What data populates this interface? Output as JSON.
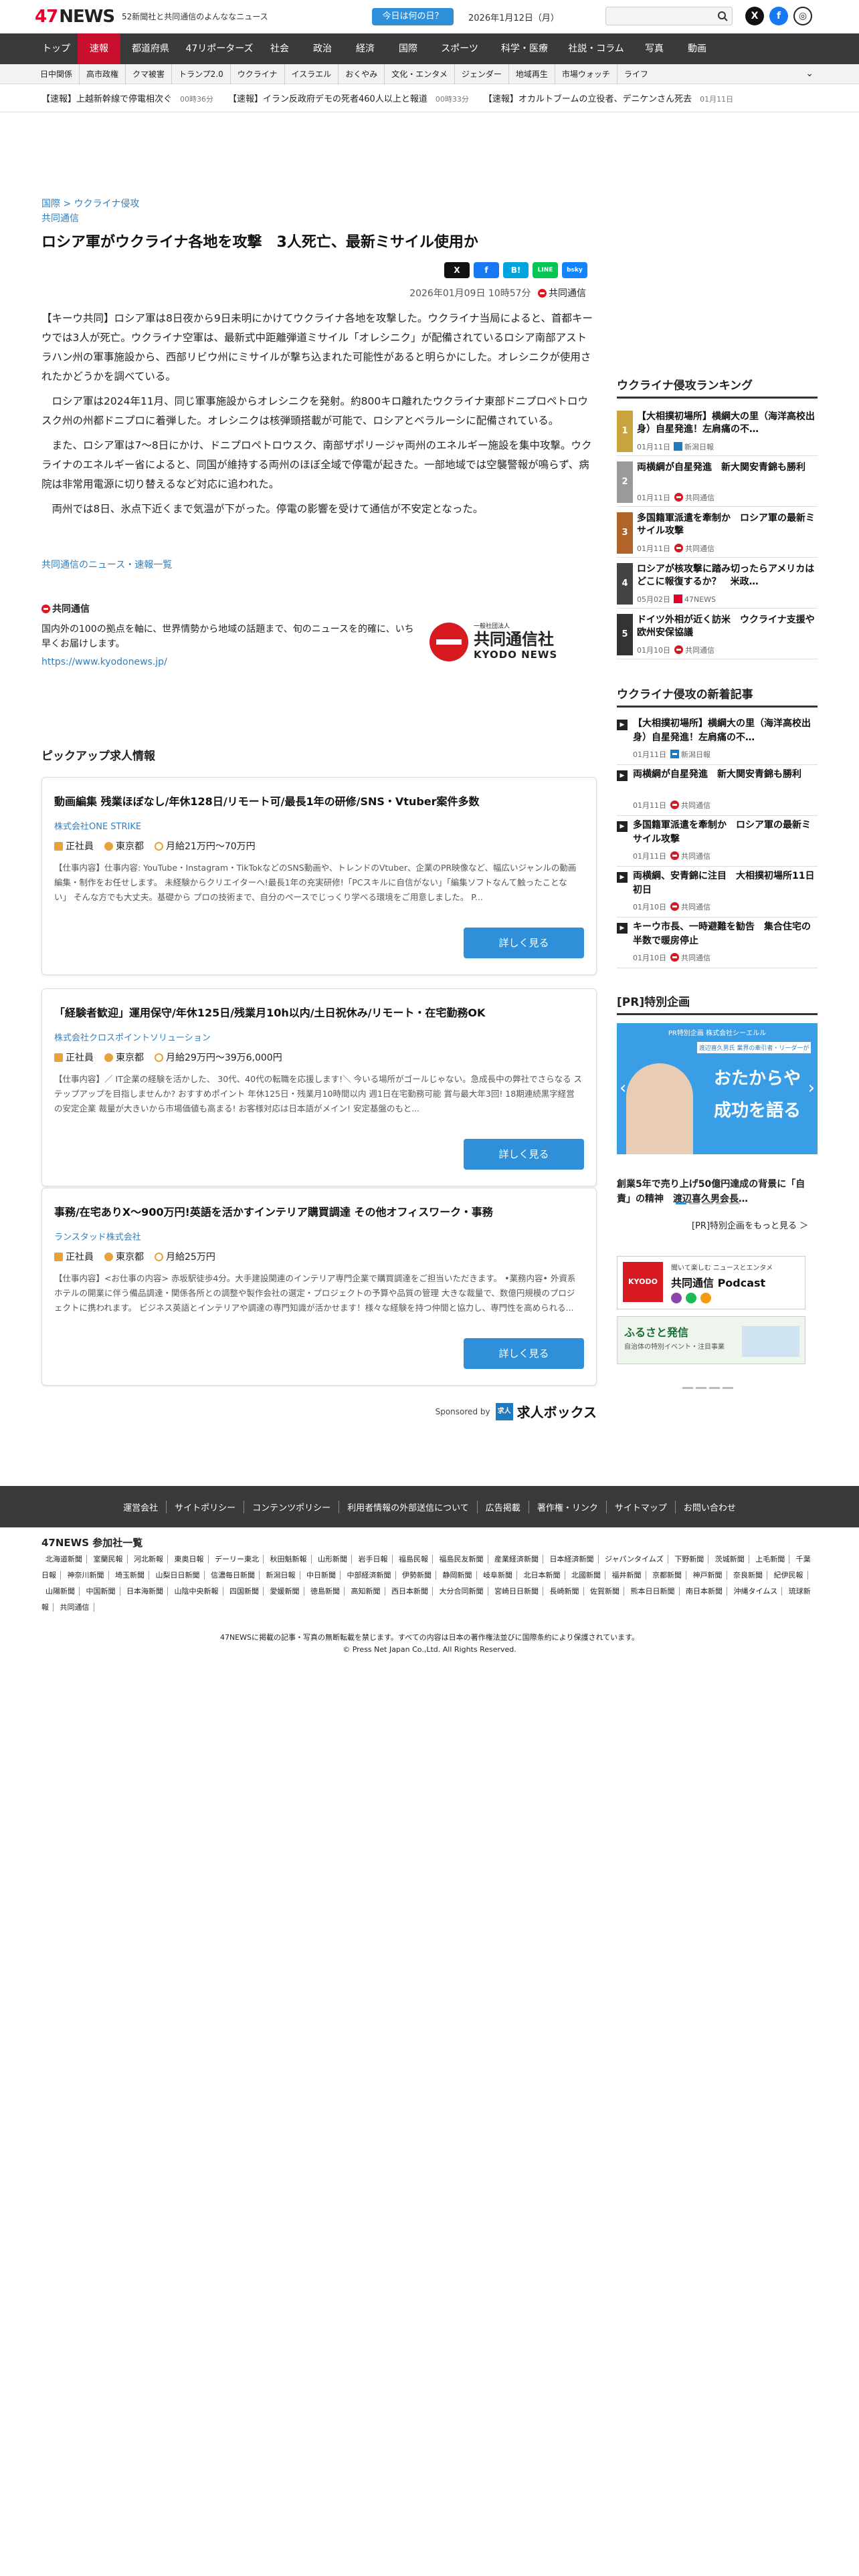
{
  "header": {
    "logo_num": "47",
    "logo_text": "NEWS",
    "tagline": "52新聞社と共同通信のよんななニュース",
    "today_button": "今日は何の日？",
    "date": "2026年1月12日（月）",
    "search_placeholder": ""
  },
  "nav": {
    "items": [
      "トップ",
      "速報",
      "都道府県",
      "47リポーターズ",
      "社会",
      "政治",
      "経済",
      "国際",
      "スポーツ",
      "科学・医療",
      "社説・コラム",
      "写真",
      "動画"
    ],
    "active": "速報"
  },
  "subnav": {
    "items": [
      "日中関係",
      "高市政権",
      "クマ被害",
      "トランプ2.0",
      "ウクライナ",
      "イスラエル",
      "おくやみ",
      "文化・エンタメ",
      "ジェンダー",
      "地域再生",
      "市場ウォッチ",
      "ライフ"
    ]
  },
  "ticker": [
    {
      "text": "【速報】上越新幹線で停電相次ぐ",
      "time": "00時36分"
    },
    {
      "text": "【速報】イラン反政府デモの死者460人以上と報道",
      "time": "00時33分"
    },
    {
      "text": "【速報】オカルトブームの立役者、デニケンさん死去",
      "time": "01月11日"
    }
  ],
  "article": {
    "breadcrumb_parent": "国際",
    "breadcrumb_sep": ">",
    "breadcrumb_child": "ウクライナ侵攻",
    "source_label": "共同通信",
    "title": "ロシア軍がウクライナ各地を攻撃　3人死亡、最新ミサイル使用か",
    "date": "2026年01月09日 10時57分",
    "source": "共同通信",
    "paragraphs": [
      "【キーウ共同】ロシア軍は8日夜から9日未明にかけてウクライナ各地を攻撃した。ウクライナ当局によると、首都キーウでは3人が死亡。ウクライナ空軍は、最新式中距離弾道ミサイル「オレシニク」が配備されているロシア南部アストラハン州の軍事施設から、西部リビウ州にミサイルが撃ち込まれた可能性があると明らかにした。オレシニクが使用されたかどうかを調べている。",
      "ロシア軍は2024年11月、同じ軍事施設からオレシニクを発射。約800キロ離れたウクライナ東部ドニプロペトロウスク州の州都ドニプロに着弾した。オレシニクは核弾頭搭載が可能で、ロシアとベラルーシに配備されている。",
      "また、ロシア軍は7～8日にかけ、ドニプロペトロウスク、南部ザポリージャ両州のエネルギー施設を集中攻撃。ウクライナのエネルギー省によると、同国が維持する両州のほぼ全域で停電が起きた。一部地域では空襲警報が鳴らず、病院は非常用電源に切り替えるなど対応に追われた。",
      "両州では8日、氷点下近くまで気温が下がった。停電の影響を受けて通信が不安定となった。"
    ],
    "more_link": "共同通信のニュース・速報一覧"
  },
  "kyodo": {
    "name": "共同通信",
    "description": "国内外の100の拠点を軸に、世界情勢から地域の話題まで、旬のニュースを的確に、いち早くお届けします。",
    "url": "https://www.kyodonews.jp/",
    "logo_small": "一般社団法人",
    "logo_jp": "共同通信社",
    "logo_en": "KYODO NEWS"
  },
  "share": {
    "x": "X",
    "facebook": "f",
    "hatena": "B!",
    "line": "LINE",
    "bluesky": "bsky"
  },
  "jobs": {
    "heading": "ピックアップ求人情報",
    "items": [
      {
        "title": "動画編集 残業ほぼなし/年休128日/リモート可/最長1年の研修/SNS・Vtuber案件多数",
        "company": "株式会社ONE STRIKE",
        "type": "正社員",
        "location": "東京都",
        "salary": "月給21万円〜70万円",
        "desc": "【仕事内容】仕事内容: YouTube・Instagram・TikTokなどのSNS動画や、トレンドのVtuber、企業のPR映像など、幅広いジャンルの動画編集・制作をお任せします。 未経験からクリエイターへ!最長1年の充実研修!「PCスキルに自信がない」「編集ソフトなんて触ったことない」 そんな方でも大丈夫。基礎から プロの技術まで、自分のペースでじっくり学べる環境をご用意しました。 P...",
        "button": "詳しく見る"
      },
      {
        "title": "「経験者歓迎」運用保守/年休125日/残業月10h以内/土日祝休み/リモート・在宅勤務OK",
        "company": "株式会社クロスポイントソリューション",
        "type": "正社員",
        "location": "東京都",
        "salary": "月給29万円〜39万6,000円",
        "desc": "【仕事内容】／ IT企業の経験を活かした、 30代、40代の転職を応援します!＼ 今いる場所がゴールじゃない。急成長中の弊社でさらなる ステップアップを目指しませんか? おすすめポイント 年休125日・残業月10時間以内 週1日在宅勤務可能 賞与最大年3回! 18期連続黒字経営の安定企業 裁量が大きいから市場価値も高まる! お客様対応は日本語がメイン! 安定基盤のもと...",
        "button": "詳しく見る"
      },
      {
        "title": "事務/在宅ありX〜900万円!英語を活かすインテリア購買調達 その他オフィスワーク・事務",
        "company": "ランスタッド株式会社",
        "type": "正社員",
        "location": "東京都",
        "salary": "月給25万円",
        "desc": "【仕事内容】<お仕事の内容> 赤坂駅徒歩4分。大手建設関連のインテリア専門企業で購買調達をご担当いただきます。 •業務内容• 外資系ホテルの開業に伴う備品調達・関係各所との調整や製作会社の選定・プロジェクトの予算や品質の管理 大きな裁量で、数億円規模のプロジェクトに携われます。 ビジネス英語とインテリアや調達の専門知識が活かせます！様々な経験を持つ仲間と協力し、専門性を高められる...",
        "button": "詳しく見る"
      }
    ],
    "sponsor_label": "Sponsored by",
    "sponsor_name": "求人ボックス",
    "sponsor_mark": "求人"
  },
  "ranking": {
    "heading": "ウクライナ侵攻ランキング",
    "items": [
      {
        "rank": "1",
        "title": "【大相撲初場所】横綱大の里（海洋高校出身）自星発進！左肩痛の不…",
        "date": "01月11日",
        "source": "新潟日報"
      },
      {
        "rank": "2",
        "title": "両横綱が自星発進　新大関安青錦も勝利",
        "date": "01月11日",
        "source": "共同通信"
      },
      {
        "rank": "3",
        "title": "多国籍軍派遣を牽制か　ロシア軍の最新ミサイル攻撃",
        "date": "01月11日",
        "source": "共同通信"
      },
      {
        "rank": "4",
        "title": "ロシアが核攻撃に踏み切ったらアメリカはどこに報復するか？　米政…",
        "date": "05月02日",
        "source": "47NEWS"
      },
      {
        "rank": "5",
        "title": "ドイツ外相が近く訪米　ウクライナ支援や欧州安保協議",
        "date": "01月10日",
        "source": "共同通信"
      }
    ]
  },
  "latest": {
    "heading": "ウクライナ侵攻の新着記事",
    "items": [
      {
        "title": "【大相撲初場所】横綱大の里（海洋高校出身）自星発進！左肩痛の不…",
        "date": "01月11日",
        "source": "新潟日報"
      },
      {
        "title": "両横綱が自星発進　新大関安青錦も勝利",
        "date": "01月11日",
        "source": "共同通信"
      },
      {
        "title": "多国籍軍派遣を牽制か　ロシア軍の最新ミサイル攻撃",
        "date": "01月11日",
        "source": "共同通信"
      },
      {
        "title": "両横綱、安青錦に注目　大相撲初場所11日初日",
        "date": "01月10日",
        "source": "共同通信"
      },
      {
        "title": "キーウ市長、一時避難を勧告　集合住宅の半数で暖房停止",
        "date": "01月10日",
        "source": "共同通信"
      }
    ]
  },
  "pr": {
    "heading": "[PR]特別企画",
    "img_top": "PR特別企画 株式会社シーエルル",
    "img_sub": "渡辺喜久男氏 業界の牽引者・リーダーが",
    "img_main1": "おたからや",
    "img_main2": "成功を語る",
    "caption": "創業5年で売り上げ50億円達成の背景に「自責」の精神　渡辺喜久男会長…",
    "more": "[PR]特別企画をもっと見る ＞"
  },
  "podcast": {
    "brand": "KYODO",
    "title": "共同通信 Podcast",
    "sub": "聞いて楽しむ ニュースとエンタメ"
  },
  "furusato": {
    "title": "ふるさと発信",
    "sub": "自治体の特別イベント・注目事業"
  },
  "footer": {
    "links": [
      "運営会社",
      "サイトポリシー",
      "コンテンツポリシー",
      "利用者情報の外部送信について",
      "広告掲載",
      "著作権・リンク",
      "サイトマップ",
      "お問い合わせ"
    ],
    "members_heading": "47NEWS 参加社一覧",
    "members": [
      "北海道新聞",
      "室蘭民報",
      "河北新報",
      "東奥日報",
      "デーリー東北",
      "秋田魁新報",
      "山形新聞",
      "岩手日報",
      "福島民報",
      "福島民友新聞",
      "産業経済新聞",
      "日本経済新聞",
      "ジャパンタイムズ",
      "下野新聞",
      "茨城新聞",
      "上毛新聞",
      "千葉日報",
      "神奈川新聞",
      "埼玉新聞",
      "山梨日日新聞",
      "信濃毎日新聞",
      "新潟日報",
      "中日新聞",
      "中部経済新聞",
      "伊勢新聞",
      "静岡新聞",
      "岐阜新聞",
      "北日本新聞",
      "北國新聞",
      "福井新聞",
      "京都新聞",
      "神戸新聞",
      "奈良新聞",
      "紀伊民報",
      "山陽新聞",
      "中国新聞",
      "日本海新聞",
      "山陰中央新報",
      "四国新聞",
      "愛媛新聞",
      "徳島新聞",
      "高知新聞",
      "西日本新聞",
      "大分合同新聞",
      "宮崎日日新聞",
      "長崎新聞",
      "佐賀新聞",
      "熊本日日新聞",
      "南日本新聞",
      "沖縄タイムス",
      "琉球新報",
      "共同通信"
    ],
    "copyright1": "47NEWSに掲載の記事・写真の無断転載を禁じます。すべての内容は日本の著作権法並びに国際条約により保護されています。",
    "copyright2": "© Press Net Japan Co.,Ltd. All Rights Reserved."
  },
  "colors": {
    "accent": "#c8102e",
    "link": "#2f7fc1",
    "button": "#2f8fd8",
    "nav_bg": "#3a3a3a"
  }
}
